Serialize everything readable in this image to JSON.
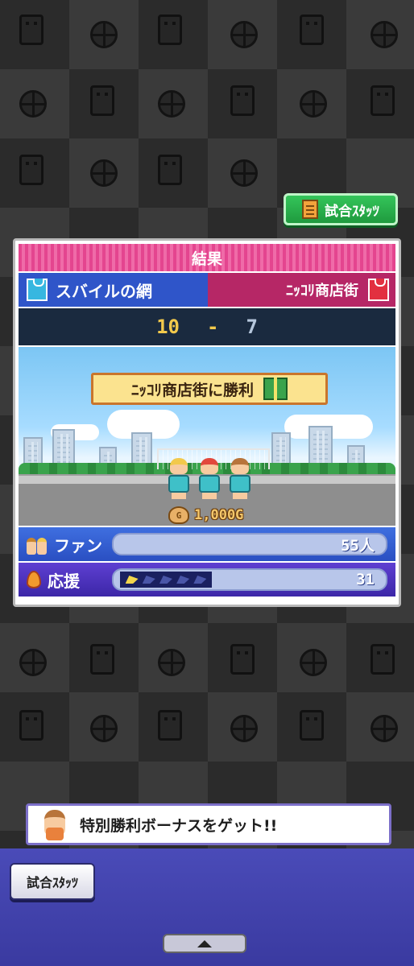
{
  "top_button": {
    "label": "試合ｽﾀｯﾂ",
    "icon": "document-icon"
  },
  "result": {
    "title": "結果",
    "home_team": {
      "name": "スバイルの網",
      "icon": "blue-jersey-icon"
    },
    "away_team": {
      "name": "ﾆｯｺﾘ商店街",
      "icon": "red-jersey-icon"
    },
    "score": {
      "home": "10",
      "separator": "-",
      "away": "7"
    },
    "banner": {
      "text": "ﾆｯｺﾘ商店街に勝利",
      "icon": "gift-box-icon"
    },
    "prize_money": "1,000G",
    "money_icon_letter": "G",
    "stats": {
      "fans": {
        "label": "ファン",
        "value": "55人"
      },
      "cheer": {
        "label": "応援",
        "value": "31",
        "meter_filled": 1,
        "meter_total": 5
      }
    }
  },
  "bonus_message": "特別勝利ボーナスをゲット!!",
  "bottom_bar": {
    "stats_button_label": "試合ｽﾀｯﾂ",
    "collapse_icon": "up-arrow-icon"
  },
  "colors": {
    "header_pink": "#e4458f",
    "home_blue": "#2f55c9",
    "away_magenta": "#b62766",
    "score_gold": "#f2c94c",
    "green_button": "#34c55a"
  }
}
